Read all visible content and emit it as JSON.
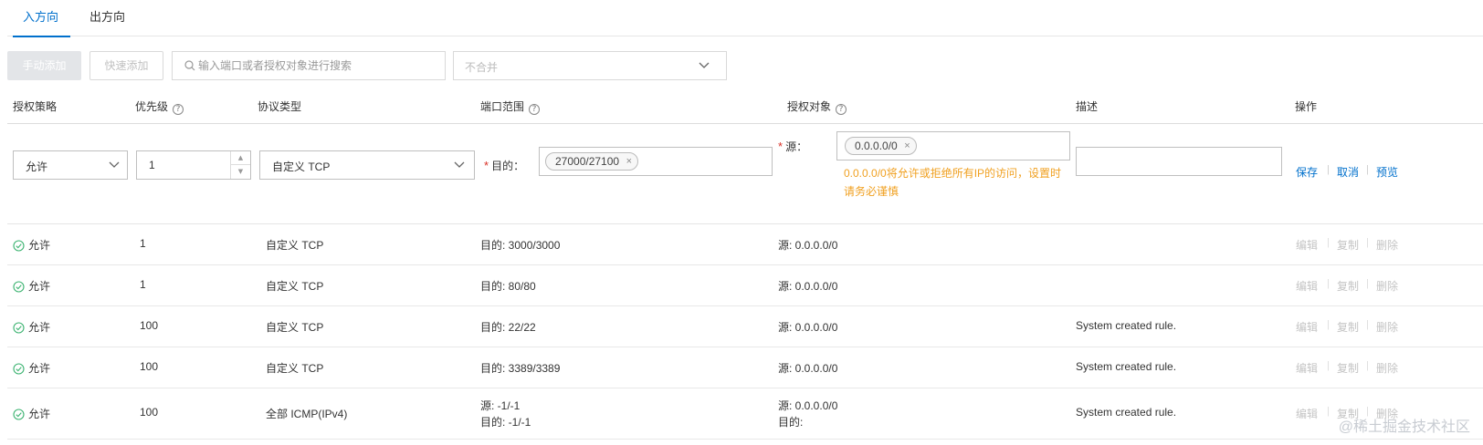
{
  "tabs": {
    "inbound": "入方向",
    "outbound": "出方向"
  },
  "toolbar": {
    "manual_add": "手动添加",
    "quick_add": "快速添加",
    "search_placeholder": "输入端口或者授权对象进行搜索",
    "merge_value": "不合并"
  },
  "columns": {
    "policy": "授权策略",
    "priority": "优先级",
    "protocol": "协议类型",
    "port_range": "端口范围",
    "auth_object": "授权对象",
    "description": "描述",
    "actions": "操作",
    "help_glyph": "?"
  },
  "edit_row": {
    "policy": "允许",
    "priority": "1",
    "protocol": "自定义 TCP",
    "dest_label": "目的：",
    "dest_chip": "27000/27100",
    "source_label": "源：",
    "source_chip": "0.0.0.0/0",
    "chip_remove": "×",
    "warning": "0.0.0.0/0将允许或拒绝所有IP的访问，设置时请务必谨慎",
    "description": "",
    "save": "保存",
    "cancel": "取消",
    "preview": "预览",
    "separator": "|"
  },
  "row_actions": {
    "edit": "编辑",
    "copy": "复制",
    "delete": "删除",
    "separator": "|"
  },
  "rows": [
    {
      "policy": "允许",
      "priority": "1",
      "protocol": "自定义 TCP",
      "port_line1": "目的: 3000/3000",
      "port_line2": "",
      "auth_line1": "源: 0.0.0.0/0",
      "auth_line2": "",
      "description": ""
    },
    {
      "policy": "允许",
      "priority": "1",
      "protocol": "自定义 TCP",
      "port_line1": "目的: 80/80",
      "port_line2": "",
      "auth_line1": "源: 0.0.0.0/0",
      "auth_line2": "",
      "description": ""
    },
    {
      "policy": "允许",
      "priority": "100",
      "protocol": "自定义 TCP",
      "port_line1": "目的: 22/22",
      "port_line2": "",
      "auth_line1": "源: 0.0.0.0/0",
      "auth_line2": "",
      "description": "System created rule."
    },
    {
      "policy": "允许",
      "priority": "100",
      "protocol": "自定义 TCP",
      "port_line1": "目的: 3389/3389",
      "port_line2": "",
      "auth_line1": "源: 0.0.0.0/0",
      "auth_line2": "",
      "description": "System created rule."
    },
    {
      "policy": "允许",
      "priority": "100",
      "protocol": "全部 ICMP(IPv4)",
      "port_line1": "源: -1/-1",
      "port_line2": "目的: -1/-1",
      "auth_line1": "源: 0.0.0.0/0",
      "auth_line2": "目的:",
      "description": "System created rule."
    }
  ],
  "watermark": "@稀土掘金技术社区",
  "colors": {
    "accent": "#0070cc",
    "warning": "#f0a020",
    "required": "#d93026",
    "allow_icon": "#3cb371",
    "disabled": "#c4c4c4"
  }
}
